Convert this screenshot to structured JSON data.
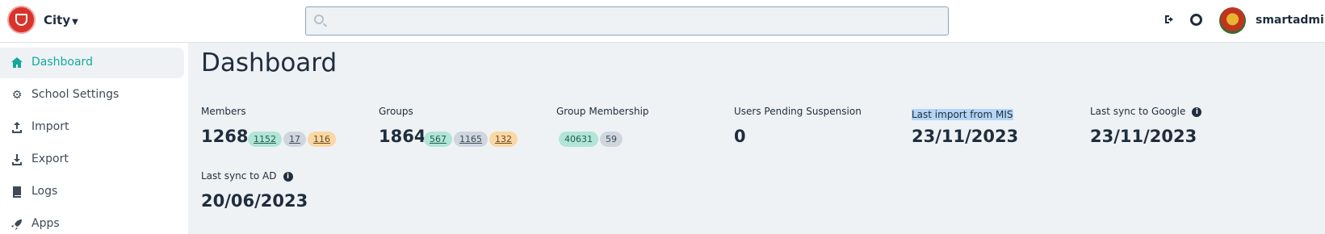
{
  "header": {
    "school_name": "City",
    "search": {
      "placeholder": "",
      "value": ""
    },
    "username": "smartadmin",
    "icons": [
      "logo-icon",
      "search-icon",
      "logout-icon",
      "help-icon",
      "avatar"
    ]
  },
  "sidebar": {
    "items": [
      {
        "label": "Dashboard",
        "icon": "home-icon",
        "active": true
      },
      {
        "label": "School Settings",
        "icon": "gear-icon",
        "active": false
      },
      {
        "label": "Import",
        "icon": "upload-icon",
        "active": false
      },
      {
        "label": "Export",
        "icon": "download-icon",
        "active": false
      },
      {
        "label": "Logs",
        "icon": "book-icon",
        "active": false
      },
      {
        "label": "Apps",
        "icon": "rocket-icon",
        "active": false
      }
    ]
  },
  "main": {
    "title": "Dashboard",
    "stats": {
      "members": {
        "label": "Members",
        "value": "1268",
        "badges": [
          "1152",
          "17",
          "116"
        ]
      },
      "groups": {
        "label": "Groups",
        "value": "1864",
        "badges": [
          "567",
          "1165",
          "132"
        ]
      },
      "group_membership": {
        "label": "Group Membership",
        "badges": [
          "40631",
          "59"
        ]
      },
      "pending_suspension": {
        "label": "Users Pending Suspension",
        "value": "0"
      },
      "last_import": {
        "label": "Last import from MIS",
        "value": "23/11/2023",
        "selected": true
      },
      "last_sync_google": {
        "label": "Last sync to Google",
        "value": "23/11/2023"
      },
      "last_sync_ad": {
        "label": "Last sync to AD",
        "value": "20/06/2023"
      }
    }
  },
  "colors": {
    "accent": "#14a89a",
    "badge_green": "#b2e5d7",
    "badge_grey": "#cfd6de",
    "badge_orange": "#fad7a4",
    "brand_red": "#d9342b",
    "text_dark": "#1f2d3d"
  }
}
